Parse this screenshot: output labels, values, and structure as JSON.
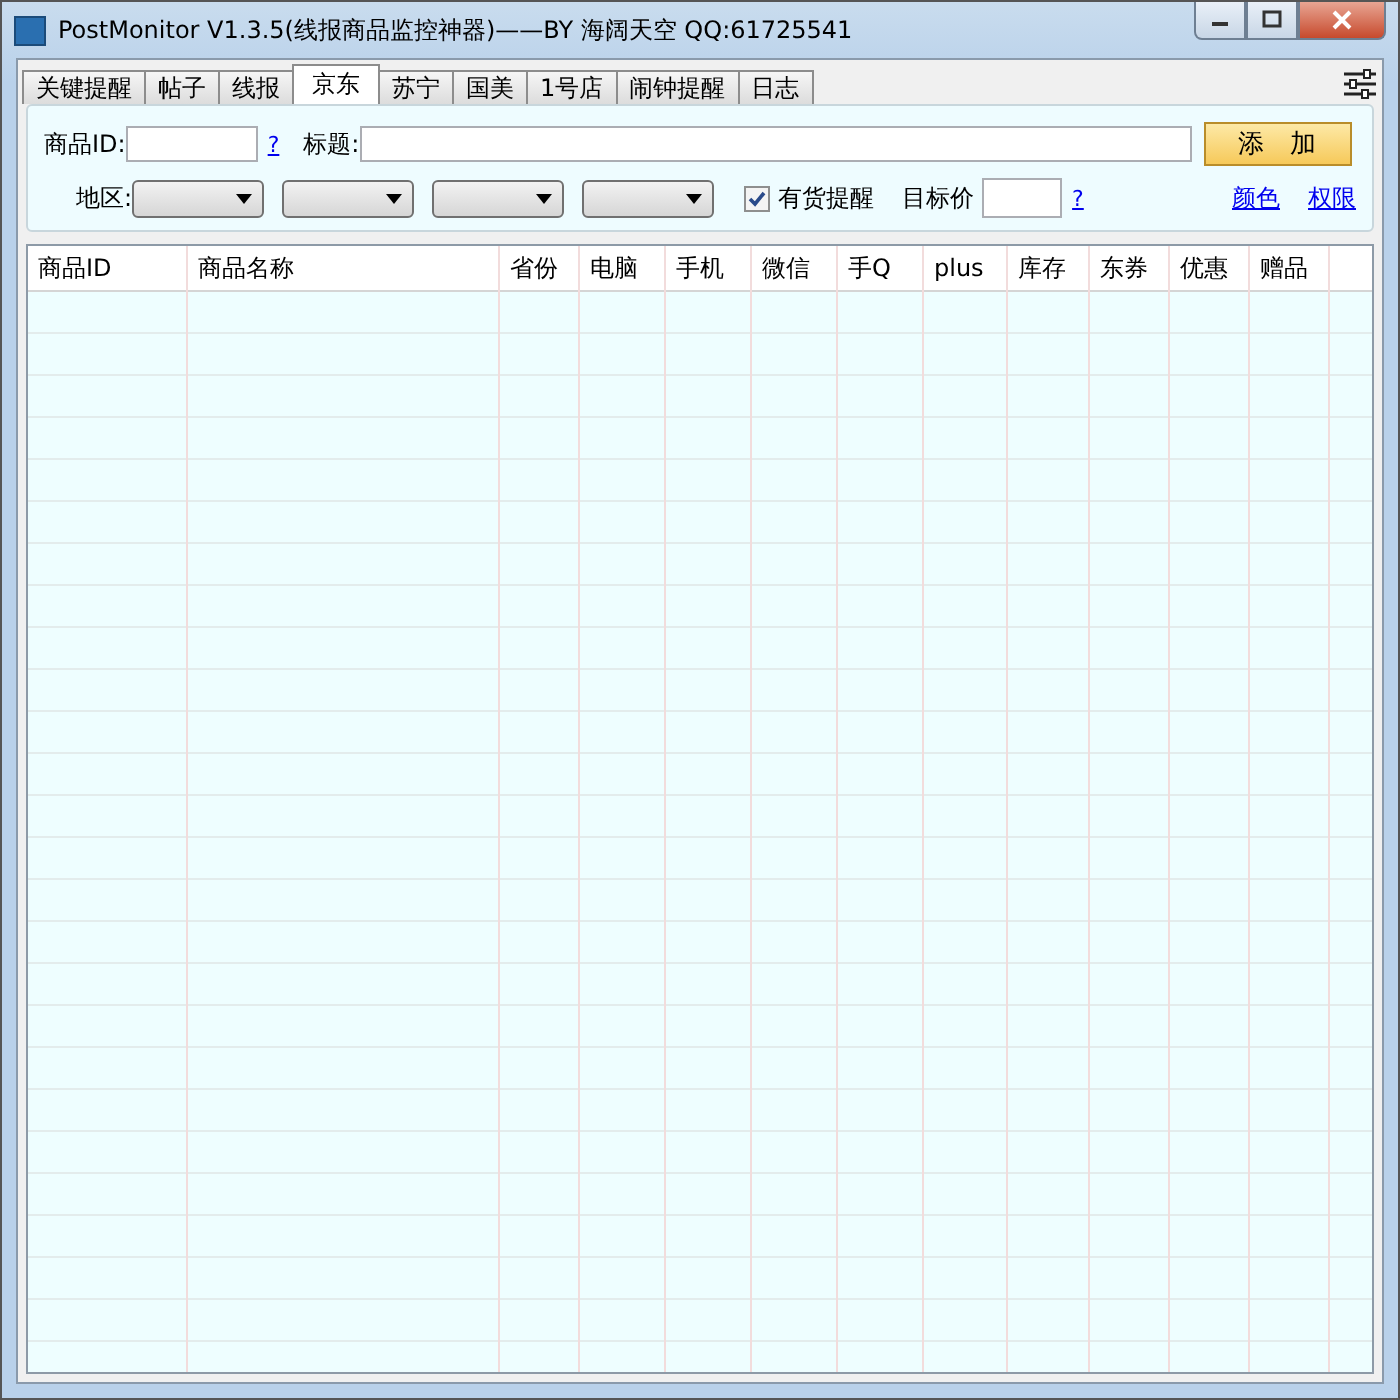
{
  "window": {
    "title": "PostMonitor V1.3.5(线报商品监控神器)——BY 海阔天空 QQ:61725541"
  },
  "tabs": [
    {
      "label": "关键提醒",
      "selected": false
    },
    {
      "label": "帖子",
      "selected": false
    },
    {
      "label": "线报",
      "selected": false
    },
    {
      "label": "京东",
      "selected": true
    },
    {
      "label": "苏宁",
      "selected": false
    },
    {
      "label": "国美",
      "selected": false
    },
    {
      "label": "1号店",
      "selected": false
    },
    {
      "label": "闹钟提醒",
      "selected": false
    },
    {
      "label": "日志",
      "selected": false
    }
  ],
  "form": {
    "id_label": "商品ID:",
    "id_help": "?",
    "title_label": "标题:",
    "add_button": "添　加",
    "region_label": "地区:",
    "stock_alert": {
      "label": "有货提醒",
      "checked": true
    },
    "target_price_label": "目标价",
    "price_help": "?",
    "links": [
      "颜色",
      "权限"
    ]
  },
  "table": {
    "columns": [
      "商品ID",
      "商品名称",
      "省份",
      "电脑",
      "手机",
      "微信",
      "手Q",
      "plus",
      "库存",
      "东券",
      "优惠",
      "赠品"
    ]
  }
}
